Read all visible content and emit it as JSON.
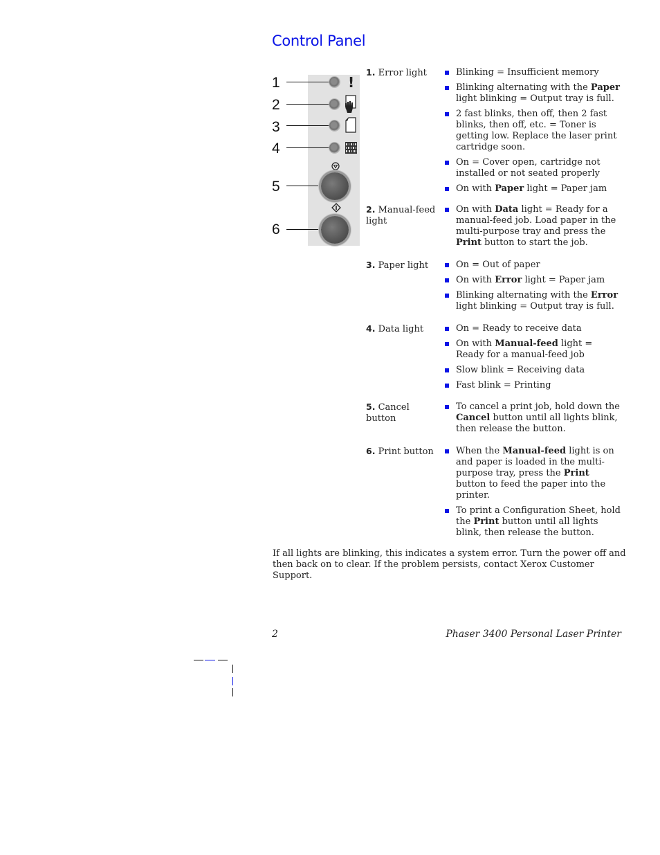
{
  "title": "Control Panel",
  "panel": {
    "callouts": [
      "1",
      "2",
      "3",
      "4",
      "5",
      "6"
    ],
    "icons": {
      "error": "!",
      "manual_feed": "hand-paper",
      "paper": "paper-sheet",
      "data": "data-grid",
      "cancel": "cancel-symbol",
      "print": "print-diamond"
    }
  },
  "entries": [
    {
      "num": "1.",
      "label": "Error light",
      "items": [
        [
          {
            "t": "Blinking = Insufficient memory"
          }
        ],
        [
          {
            "t": "Blinking alternating with the "
          },
          {
            "b": "Paper"
          },
          {
            "t": " light blinking = Output tray is full."
          }
        ],
        [
          {
            "t": "2  fast blinks, then off, then 2 fast blinks, then off, etc. = Toner is getting low.  Replace the laser print cartridge soon."
          }
        ],
        [
          {
            "t": "On = Cover open, cartridge not installed or not seated properly"
          }
        ],
        [
          {
            "t": "On with "
          },
          {
            "b": "Paper"
          },
          {
            "t": " light = Paper jam"
          }
        ]
      ]
    },
    {
      "num": "2.",
      "label": "Manual-feed light",
      "items": [
        [
          {
            "t": "On with "
          },
          {
            "b": "Data"
          },
          {
            "t": " light = Ready for a manual-feed job. Load paper in the multi-purpose tray and press the "
          },
          {
            "b": "Print"
          },
          {
            "t": " button to start the job."
          }
        ]
      ]
    },
    {
      "num": "3.",
      "label": "Paper light",
      "items": [
        [
          {
            "t": "On = Out of paper"
          }
        ],
        [
          {
            "t": "On with "
          },
          {
            "b": "Error"
          },
          {
            "t": " light = Paper jam"
          }
        ],
        [
          {
            "t": "Blinking alternating with the "
          },
          {
            "b": "Error"
          },
          {
            "t": " light blinking = Output tray is full."
          }
        ]
      ]
    },
    {
      "num": "4.",
      "label": "Data light",
      "items": [
        [
          {
            "t": "On = Ready to receive data"
          }
        ],
        [
          {
            "t": "On with "
          },
          {
            "b": "Manual-feed"
          },
          {
            "t": " light = Ready for a manual-feed job"
          }
        ],
        [
          {
            "t": "Slow blink = Receiving data"
          }
        ],
        [
          {
            "t": "Fast blink = Printing"
          }
        ]
      ]
    },
    {
      "num": "5.",
      "label": "Cancel button",
      "items": [
        [
          {
            "t": "To cancel a print job, hold down the "
          },
          {
            "b": "Cancel"
          },
          {
            "t": " button until all lights blink, then release the button."
          }
        ]
      ]
    },
    {
      "num": "6.",
      "label": "Print button",
      "items": [
        [
          {
            "t": "When the "
          },
          {
            "b": "Manual-feed"
          },
          {
            "t": " light is on and paper is loaded in the multi-purpose tray, press the "
          },
          {
            "b": "Print"
          },
          {
            "t": " button to feed the paper into the printer."
          }
        ],
        [
          {
            "t": "To print a Configuration Sheet, hold the "
          },
          {
            "b": "Print"
          },
          {
            "t": " button until all lights blink, then release the button."
          }
        ]
      ]
    }
  ],
  "note": "If all lights are blinking, this indicates a system error. Turn the power off and then back on to clear. If the problem persists, contact Xerox Customer Support.",
  "footer": {
    "page": "2",
    "product": "Phaser 3400 Personal Laser Printer"
  },
  "colors": {
    "accent": "#0a14e6"
  }
}
